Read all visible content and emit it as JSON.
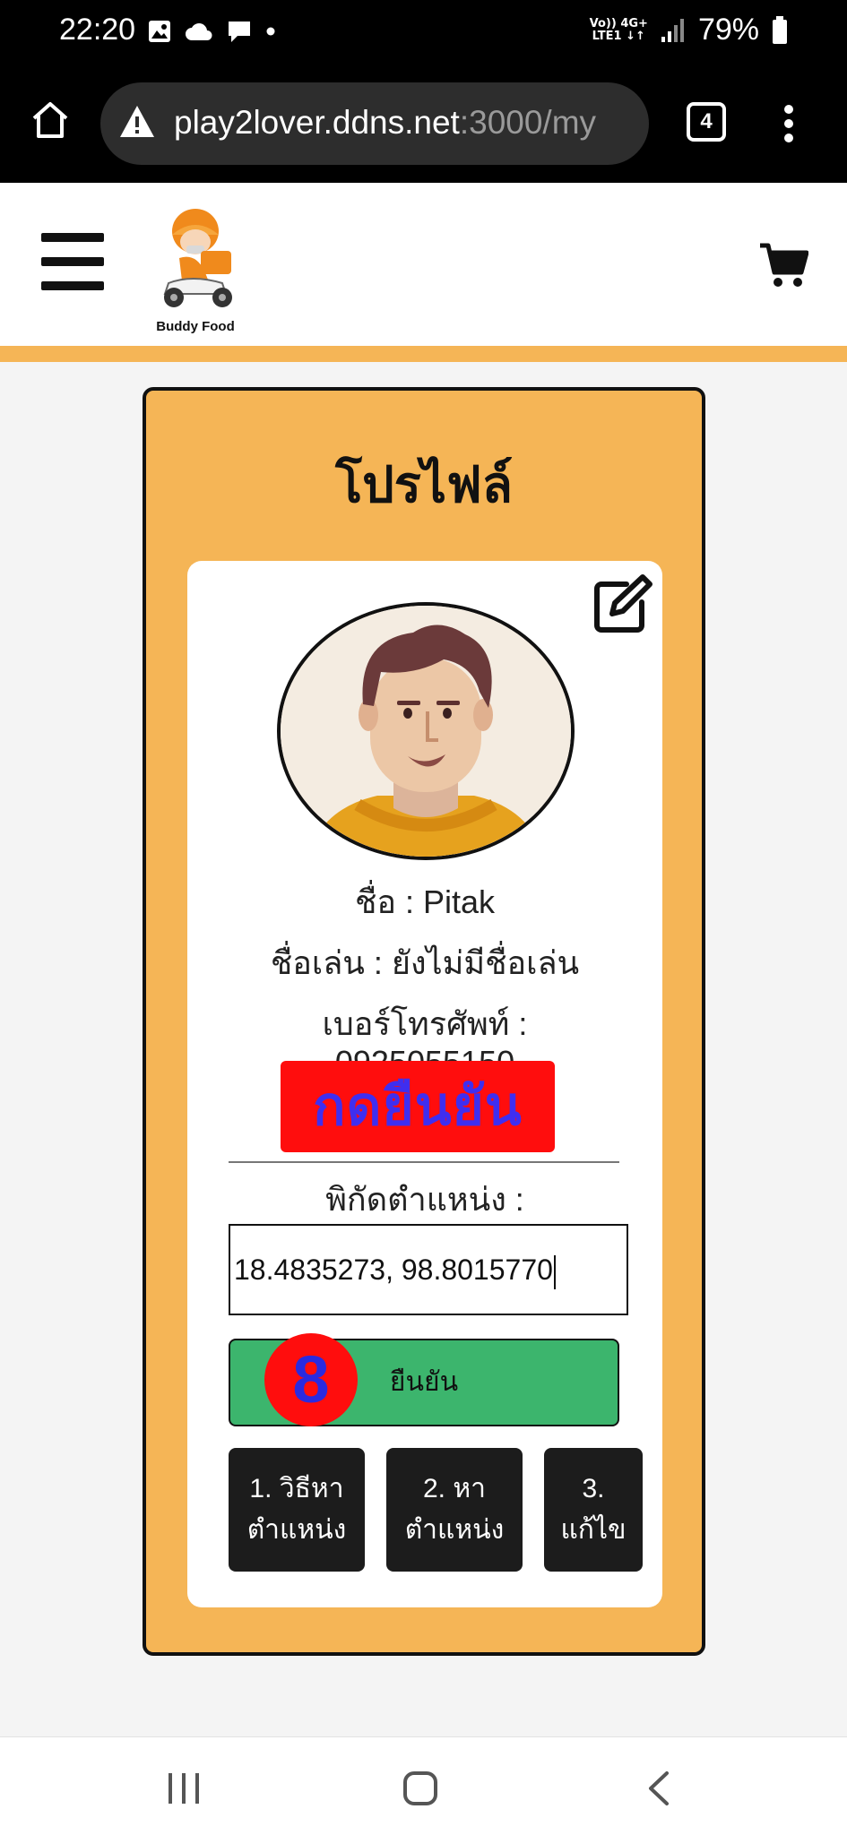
{
  "status_bar": {
    "time": "22:20",
    "battery": "79%",
    "network_line1": "Vo)) 4G+",
    "network_line2": "LTE1 ↓↑"
  },
  "browser": {
    "url_main": "play2lover.ddns.net",
    "url_rest": ":3000/my",
    "tab_count": "4"
  },
  "header": {
    "logo_text": "Buddy Food"
  },
  "profile": {
    "title": "โปรไฟล์",
    "name_line": "ชื่อ : Pitak",
    "nickname_line": "ชื่อเล่น : ยังไม่มีชื่อเล่น",
    "phone_label": "เบอร์โทรศัพท์ :",
    "phone_value": "0925055150",
    "press_confirm_overlay": "กดยืนยัน",
    "location_label": "พิกัดตำแหน่ง :",
    "coordinates": "18.4835273, 98.8015770",
    "confirm_button": "ยืนยัน",
    "step_badge": "8",
    "steps": [
      {
        "line1": "1. วิธีหา",
        "line2": "ตำแหน่ง"
      },
      {
        "line1": "2. หา",
        "line2": "ตำแหน่ง"
      },
      {
        "line1": "3.",
        "line2": "แก้ไข"
      }
    ]
  },
  "colors": {
    "accent": "#f5b556",
    "confirm_green": "#3cb56d",
    "overlay_red": "#ff0d0d",
    "overlay_text_blue": "#3f2ef0"
  }
}
